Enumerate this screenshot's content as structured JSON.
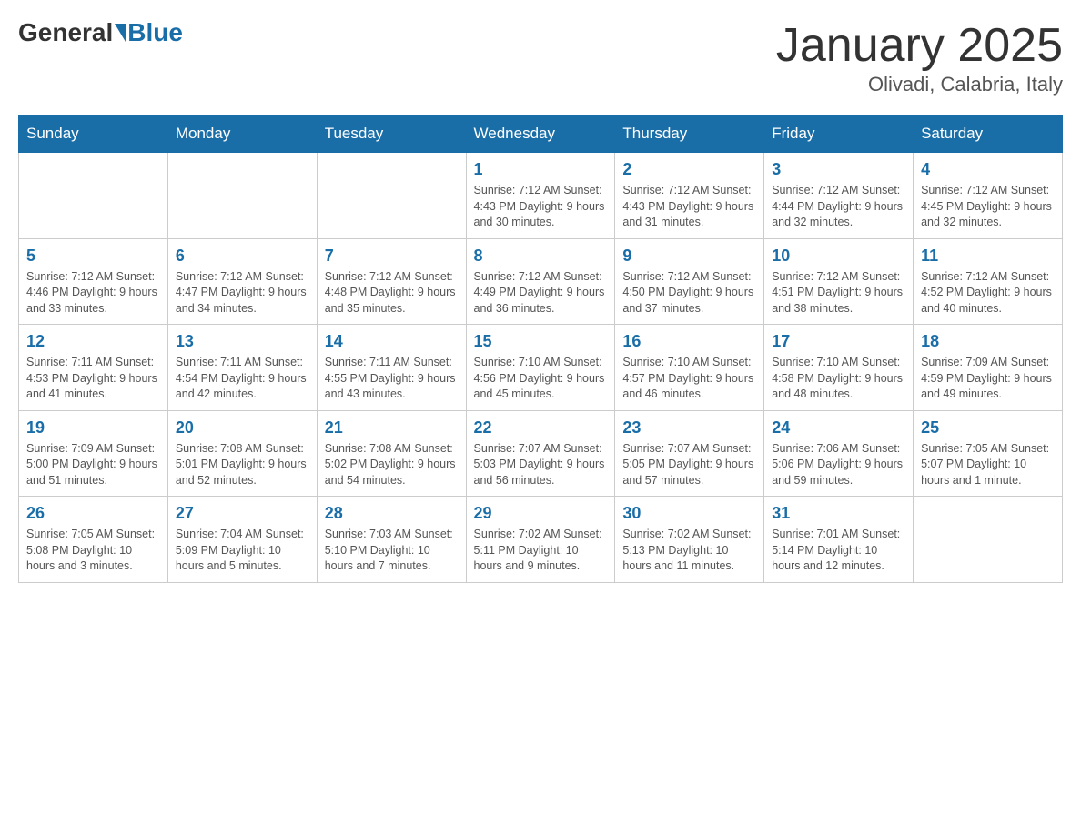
{
  "header": {
    "logo_general": "General",
    "logo_blue": "Blue",
    "title": "January 2025",
    "subtitle": "Olivadi, Calabria, Italy"
  },
  "weekdays": [
    "Sunday",
    "Monday",
    "Tuesday",
    "Wednesday",
    "Thursday",
    "Friday",
    "Saturday"
  ],
  "weeks": [
    [
      {
        "day": "",
        "info": ""
      },
      {
        "day": "",
        "info": ""
      },
      {
        "day": "",
        "info": ""
      },
      {
        "day": "1",
        "info": "Sunrise: 7:12 AM\nSunset: 4:43 PM\nDaylight: 9 hours and 30 minutes."
      },
      {
        "day": "2",
        "info": "Sunrise: 7:12 AM\nSunset: 4:43 PM\nDaylight: 9 hours and 31 minutes."
      },
      {
        "day": "3",
        "info": "Sunrise: 7:12 AM\nSunset: 4:44 PM\nDaylight: 9 hours and 32 minutes."
      },
      {
        "day": "4",
        "info": "Sunrise: 7:12 AM\nSunset: 4:45 PM\nDaylight: 9 hours and 32 minutes."
      }
    ],
    [
      {
        "day": "5",
        "info": "Sunrise: 7:12 AM\nSunset: 4:46 PM\nDaylight: 9 hours and 33 minutes."
      },
      {
        "day": "6",
        "info": "Sunrise: 7:12 AM\nSunset: 4:47 PM\nDaylight: 9 hours and 34 minutes."
      },
      {
        "day": "7",
        "info": "Sunrise: 7:12 AM\nSunset: 4:48 PM\nDaylight: 9 hours and 35 minutes."
      },
      {
        "day": "8",
        "info": "Sunrise: 7:12 AM\nSunset: 4:49 PM\nDaylight: 9 hours and 36 minutes."
      },
      {
        "day": "9",
        "info": "Sunrise: 7:12 AM\nSunset: 4:50 PM\nDaylight: 9 hours and 37 minutes."
      },
      {
        "day": "10",
        "info": "Sunrise: 7:12 AM\nSunset: 4:51 PM\nDaylight: 9 hours and 38 minutes."
      },
      {
        "day": "11",
        "info": "Sunrise: 7:12 AM\nSunset: 4:52 PM\nDaylight: 9 hours and 40 minutes."
      }
    ],
    [
      {
        "day": "12",
        "info": "Sunrise: 7:11 AM\nSunset: 4:53 PM\nDaylight: 9 hours and 41 minutes."
      },
      {
        "day": "13",
        "info": "Sunrise: 7:11 AM\nSunset: 4:54 PM\nDaylight: 9 hours and 42 minutes."
      },
      {
        "day": "14",
        "info": "Sunrise: 7:11 AM\nSunset: 4:55 PM\nDaylight: 9 hours and 43 minutes."
      },
      {
        "day": "15",
        "info": "Sunrise: 7:10 AM\nSunset: 4:56 PM\nDaylight: 9 hours and 45 minutes."
      },
      {
        "day": "16",
        "info": "Sunrise: 7:10 AM\nSunset: 4:57 PM\nDaylight: 9 hours and 46 minutes."
      },
      {
        "day": "17",
        "info": "Sunrise: 7:10 AM\nSunset: 4:58 PM\nDaylight: 9 hours and 48 minutes."
      },
      {
        "day": "18",
        "info": "Sunrise: 7:09 AM\nSunset: 4:59 PM\nDaylight: 9 hours and 49 minutes."
      }
    ],
    [
      {
        "day": "19",
        "info": "Sunrise: 7:09 AM\nSunset: 5:00 PM\nDaylight: 9 hours and 51 minutes."
      },
      {
        "day": "20",
        "info": "Sunrise: 7:08 AM\nSunset: 5:01 PM\nDaylight: 9 hours and 52 minutes."
      },
      {
        "day": "21",
        "info": "Sunrise: 7:08 AM\nSunset: 5:02 PM\nDaylight: 9 hours and 54 minutes."
      },
      {
        "day": "22",
        "info": "Sunrise: 7:07 AM\nSunset: 5:03 PM\nDaylight: 9 hours and 56 minutes."
      },
      {
        "day": "23",
        "info": "Sunrise: 7:07 AM\nSunset: 5:05 PM\nDaylight: 9 hours and 57 minutes."
      },
      {
        "day": "24",
        "info": "Sunrise: 7:06 AM\nSunset: 5:06 PM\nDaylight: 9 hours and 59 minutes."
      },
      {
        "day": "25",
        "info": "Sunrise: 7:05 AM\nSunset: 5:07 PM\nDaylight: 10 hours and 1 minute."
      }
    ],
    [
      {
        "day": "26",
        "info": "Sunrise: 7:05 AM\nSunset: 5:08 PM\nDaylight: 10 hours and 3 minutes."
      },
      {
        "day": "27",
        "info": "Sunrise: 7:04 AM\nSunset: 5:09 PM\nDaylight: 10 hours and 5 minutes."
      },
      {
        "day": "28",
        "info": "Sunrise: 7:03 AM\nSunset: 5:10 PM\nDaylight: 10 hours and 7 minutes."
      },
      {
        "day": "29",
        "info": "Sunrise: 7:02 AM\nSunset: 5:11 PM\nDaylight: 10 hours and 9 minutes."
      },
      {
        "day": "30",
        "info": "Sunrise: 7:02 AM\nSunset: 5:13 PM\nDaylight: 10 hours and 11 minutes."
      },
      {
        "day": "31",
        "info": "Sunrise: 7:01 AM\nSunset: 5:14 PM\nDaylight: 10 hours and 12 minutes."
      },
      {
        "day": "",
        "info": ""
      }
    ]
  ]
}
